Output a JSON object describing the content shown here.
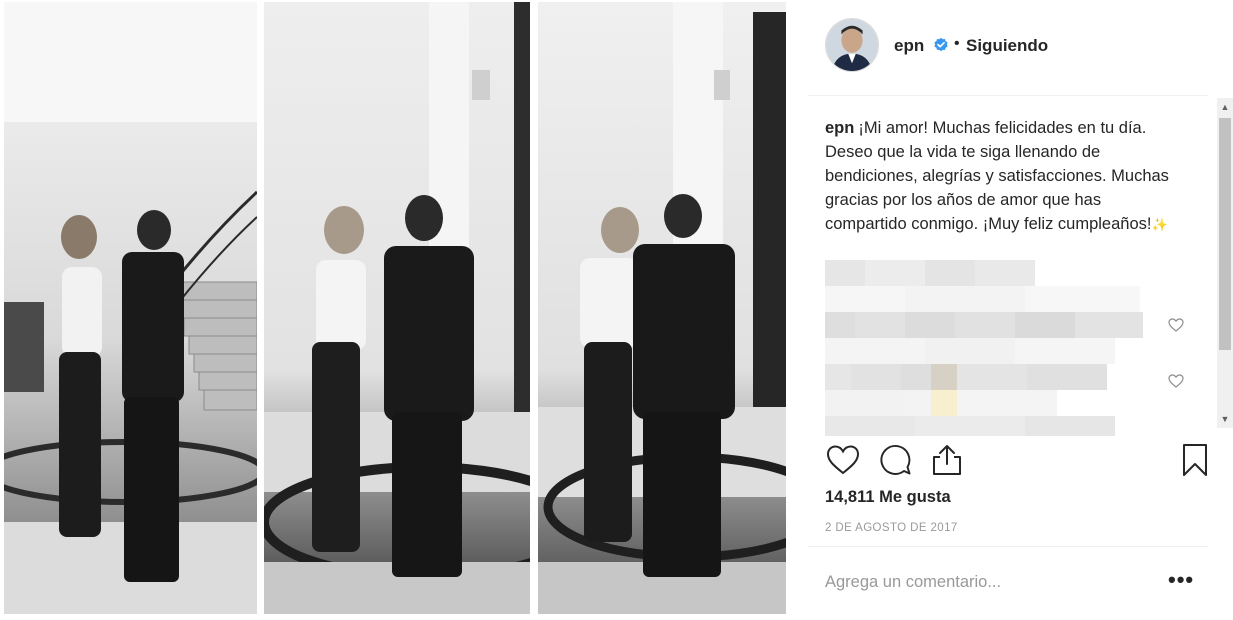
{
  "post": {
    "username": "epn",
    "separator": "•",
    "follow_status": "Siguiendo",
    "caption_user": "epn",
    "caption_text": "¡Mi amor! Muchas felicidades en tu día. Deseo que la vida te siga llenando de bendiciones, alegrías y satisfacciones. Muchas gracias por los años de amor que has compartido conmigo. ¡Muy feliz cumpleaños!",
    "caption_emoji": "✨",
    "likes": "14,811 Me gusta",
    "date": "2 DE AGOSTO DE 2017",
    "comment_placeholder": "Agrega un comentario...",
    "more_label": "•••"
  },
  "scroll": {
    "up": "▲",
    "down": "▼"
  },
  "icons": {
    "verified": "verified-badge-icon",
    "like": "heart-icon",
    "comment": "comment-icon",
    "share": "share-icon",
    "save": "bookmark-icon"
  },
  "colors": {
    "verified": "#3897f0",
    "text": "#262626",
    "muted": "#999999"
  }
}
